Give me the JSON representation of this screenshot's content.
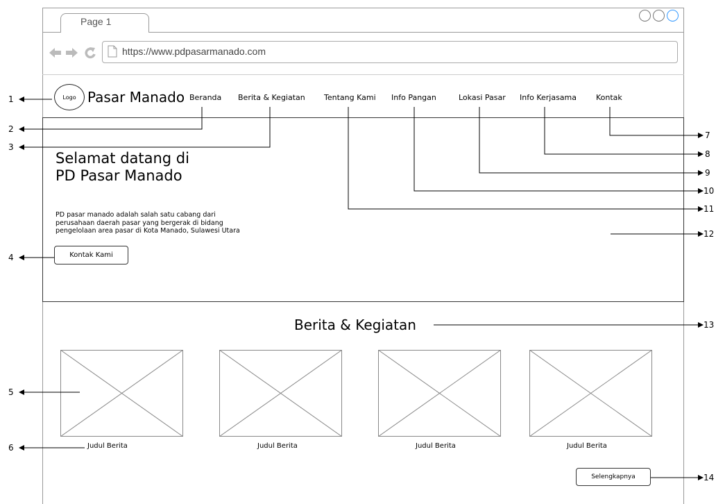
{
  "browser": {
    "tab_title": "Page 1",
    "url": "https://www.pdpasarmanado.com"
  },
  "header": {
    "logo": "Logo",
    "brand": "Pasar Manado",
    "nav": [
      "Beranda",
      "Berita & Kegiatan",
      "Tentang Kami",
      "Info Pangan",
      "Lokasi Pasar",
      "Info Kerjasama",
      "Kontak"
    ]
  },
  "hero": {
    "title": "Selamat datang di PD Pasar Manado",
    "description": "PD pasar manado adalah salah satu cabang dari perusahaan daerah pasar yang bergerak di bidang pengelolaan area pasar di Kota Manado, Sulawesi Utara",
    "button": "Kontak Kami"
  },
  "news": {
    "title": "Berita & Kegiatan",
    "cards": [
      "Judul Berita",
      "Judul Berita",
      "Judul Berita",
      "Judul Berita"
    ],
    "more_button": "Selengkapnya"
  },
  "annotations": [
    "1",
    "2",
    "3",
    "4",
    "5",
    "6",
    "7",
    "8",
    "9",
    "10",
    "11",
    "12",
    "13",
    "14"
  ]
}
